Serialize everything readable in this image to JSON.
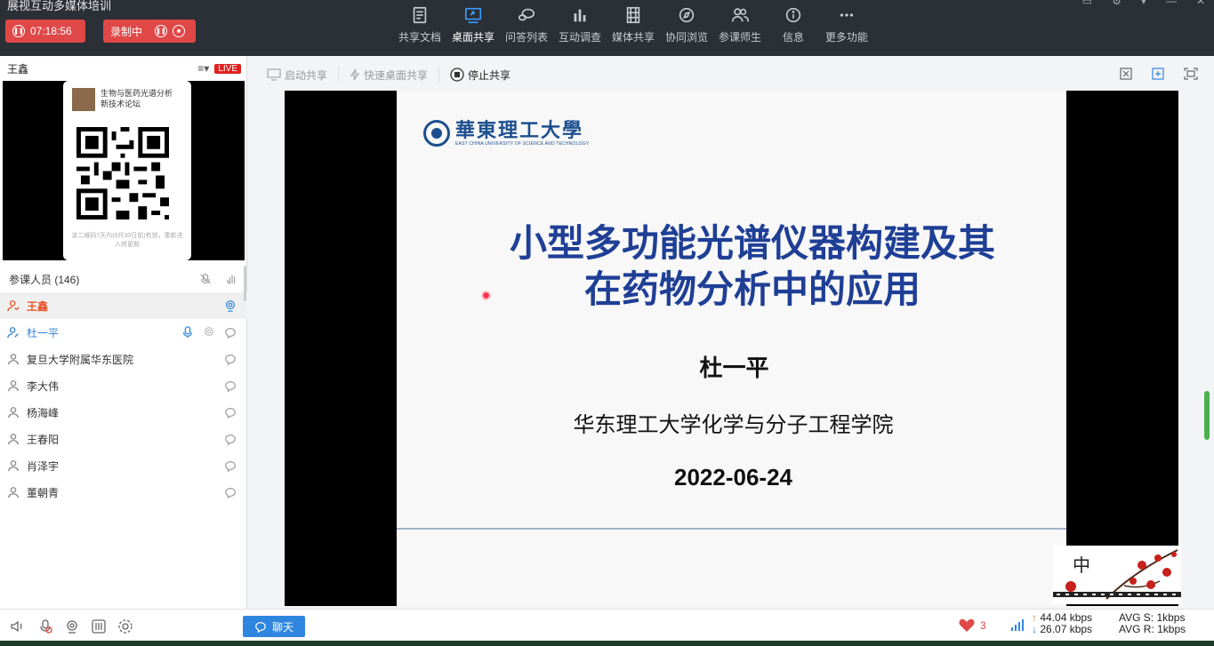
{
  "app": {
    "title": "展视互动多媒体培训"
  },
  "status": {
    "timer": "07:18:56",
    "recording_label": "录制中"
  },
  "toolbar": {
    "items": [
      {
        "label": "共享文档",
        "icon": "document-icon"
      },
      {
        "label": "桌面共享",
        "icon": "desktop-share-icon",
        "active": true
      },
      {
        "label": "问答列表",
        "icon": "qa-list-icon"
      },
      {
        "label": "互动调查",
        "icon": "survey-chart-icon"
      },
      {
        "label": "媒体共享",
        "icon": "film-icon"
      },
      {
        "label": "协同浏览",
        "icon": "compass-icon"
      },
      {
        "label": "参课师生",
        "icon": "people-icon"
      },
      {
        "label": "信息",
        "icon": "info-icon"
      },
      {
        "label": "更多功能",
        "icon": "more-icon"
      }
    ]
  },
  "presenter": {
    "name": "王鑫",
    "live_badge": "LIVE"
  },
  "qr_card": {
    "title_line1": "生物与医药光谱分析",
    "title_line2": "新技术论坛",
    "footer": "该二维码7天内(6月30日前)有效，重新进入将更新"
  },
  "participants": {
    "header": "参课人员 (146)",
    "list": [
      {
        "name": "王鑫",
        "role": "host"
      },
      {
        "name": "杜一平",
        "role": "speaker"
      },
      {
        "name": "复旦大学附属华东医院",
        "role": "attendee"
      },
      {
        "name": "李大伟",
        "role": "attendee"
      },
      {
        "name": "杨海峰",
        "role": "attendee"
      },
      {
        "name": "王春阳",
        "role": "attendee"
      },
      {
        "name": "肖泽宇",
        "role": "attendee"
      },
      {
        "name": "董朝青",
        "role": "attendee"
      }
    ]
  },
  "share_bar": {
    "start": "启动共享",
    "quick": "快速桌面共享",
    "stop": "停止共享"
  },
  "slide": {
    "university_cn": "華東理工大學",
    "university_en": "EAST CHINA UNIVERSITY OF SCIENCE AND TECHNOLOGY",
    "title_line1": "小型多功能光谱仪器构建及其",
    "title_line2": "在药物分析中的应用",
    "author": "杜一平",
    "organization": "华东理工大学化学与分子工程学院",
    "date": "2022-06-24",
    "deco_char": "中"
  },
  "bottom": {
    "chat_label": "聊天",
    "likes": "3",
    "upload": "44.04 kbps",
    "download": "26.07 kbps",
    "avg_s": "AVG S: 1kbps",
    "avg_r": "AVG R: 1kbps"
  },
  "colors": {
    "accent": "#2f86e0",
    "record_red": "#e04848",
    "slide_title": "#1f3f96",
    "topbar": "#2b2f36"
  }
}
